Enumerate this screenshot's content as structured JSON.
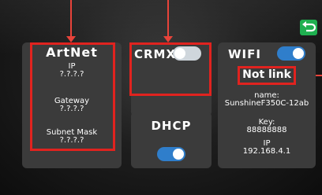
{
  "artnet": {
    "title": "ArtNet",
    "ip_label": "IP",
    "ip_value": "?.?.?.?",
    "gateway_label": "Gateway",
    "gateway_value": "?.?.?.?",
    "subnet_label": "Subnet Mask",
    "subnet_value": "?.?.?.?"
  },
  "crmx": {
    "label": "CRMX",
    "enabled": false
  },
  "dhcp": {
    "label": "DHCP",
    "enabled": true
  },
  "wifi": {
    "label": "WIFI",
    "enabled": true,
    "status": "Not link",
    "name_label": "name:",
    "name_value": "SunshineF350C-12ab",
    "key_label": "Key:",
    "key_value": "88888888",
    "ip_label": "IP",
    "ip_value": "192.168.4.1"
  },
  "colors": {
    "highlight": "#e0231f",
    "toggle_on": "#2f7ecb",
    "toggle_off": "#cfd6dc",
    "back_button": "#1fb050",
    "panel": "#3b3b3b"
  },
  "icons": {
    "back": "back-arrow-icon"
  }
}
